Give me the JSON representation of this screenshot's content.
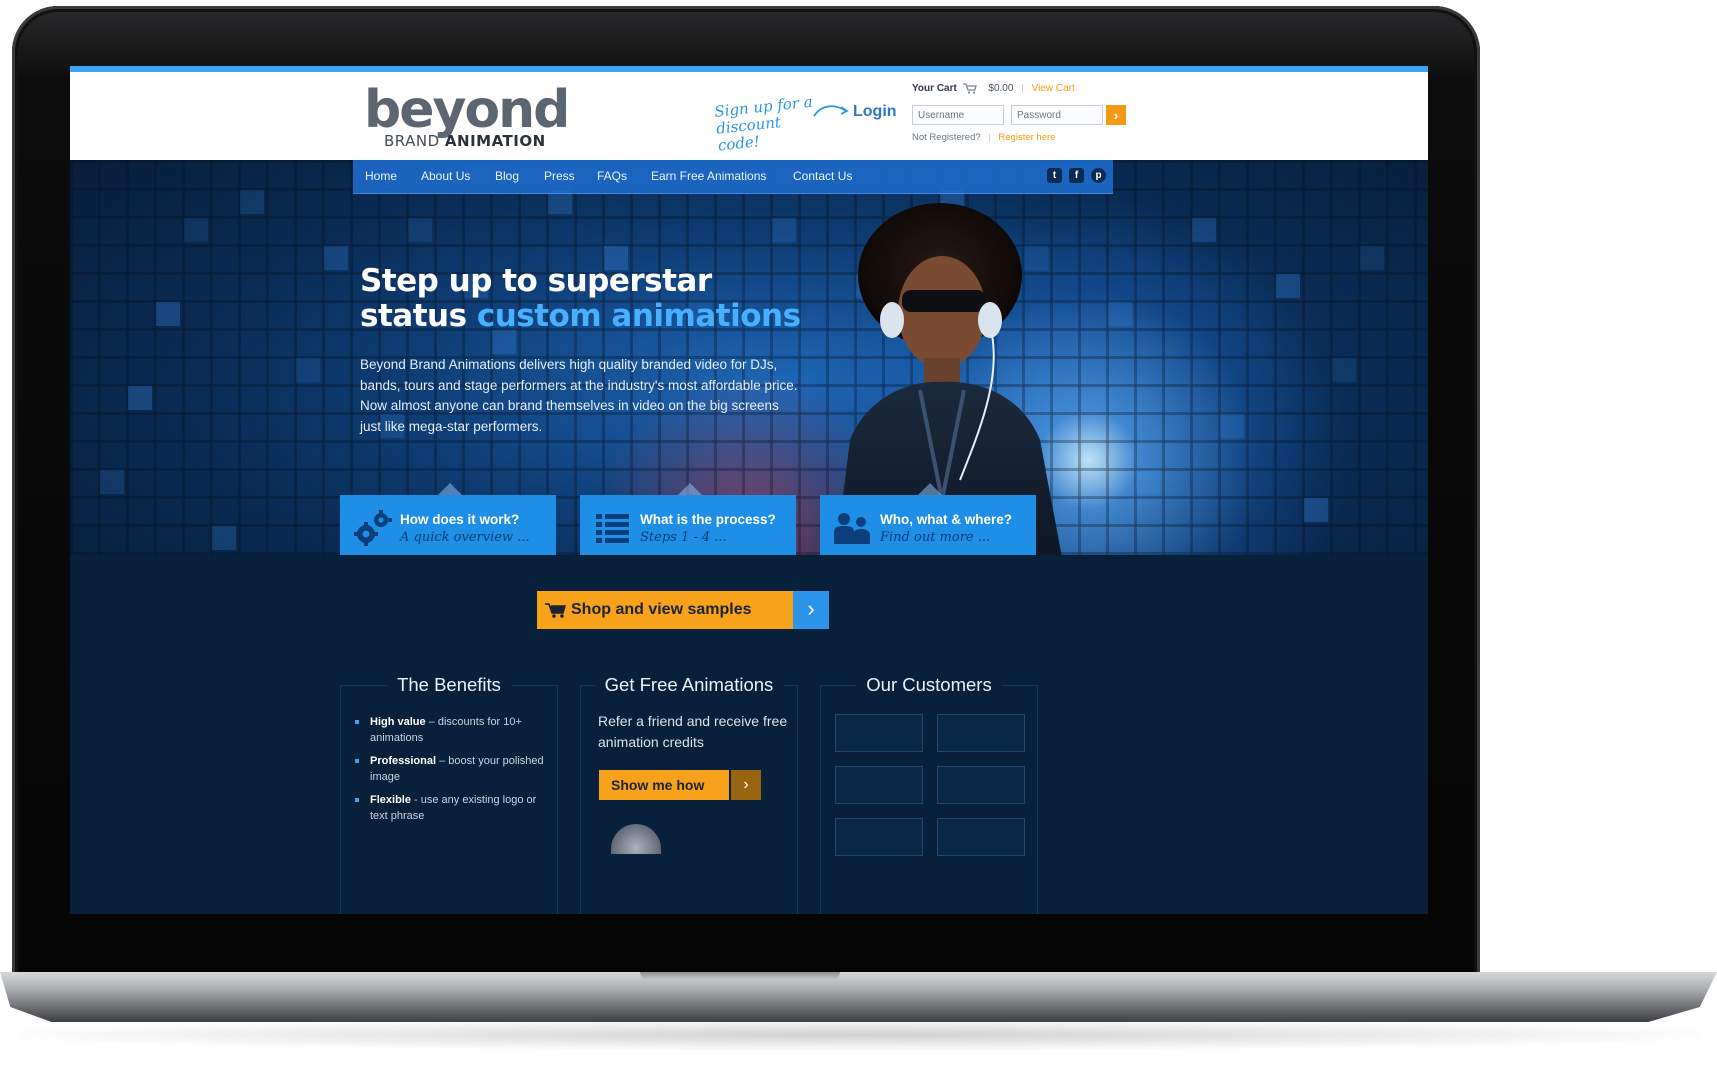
{
  "header": {
    "logo_main": "beyond",
    "logo_sub_left": "BRAND",
    "logo_sub_right": "ANIMATION",
    "signup_note": "Sign up for a discount code!",
    "login_label": "Login",
    "cart": {
      "label": "Your Cart",
      "amount": "$0.00",
      "view_link": "View Cart"
    },
    "username_placeholder": "Username",
    "password_placeholder": "Password",
    "go_label": "›",
    "not_registered": "Not Registered?",
    "register_link": "Register here"
  },
  "nav": {
    "items": [
      "Home",
      "About Us",
      "Blog",
      "Press",
      "FAQs",
      "Earn Free Animations",
      "Contact Us"
    ],
    "social": [
      "twitter-icon",
      "facebook-icon",
      "pinterest-icon"
    ]
  },
  "hero": {
    "headline_line1": "Step up to superstar",
    "headline_line2_plain": "status",
    "headline_line2_highlight": "custom animations",
    "paragraph": "Beyond Brand Animations delivers high quality branded video for DJs, bands, tours and stage performers at the industry's most affordable price. Now almost anyone can brand themselves in video on the big screens just like mega-star performers."
  },
  "features": [
    {
      "title": "How does it work?",
      "subtitle": "A quick overview ...",
      "icon": "gears-icon"
    },
    {
      "title": "What is the process?",
      "subtitle": "Steps 1 - 4 ...",
      "icon": "list-icon"
    },
    {
      "title": "Who, what & where?",
      "subtitle": "Find out more ...",
      "icon": "people-icon"
    }
  ],
  "cta": {
    "label": "Shop and view samples",
    "arrow": "›"
  },
  "columns": {
    "benefits": {
      "title": "The Benefits",
      "items": [
        {
          "bold": "High value",
          "text": " – discounts for 10+ animations"
        },
        {
          "bold": "Professional",
          "text": " – boost your polished image"
        },
        {
          "bold": "Flexible",
          "text": " - use any existing logo or text phrase"
        }
      ]
    },
    "free": {
      "title": "Get Free Animations",
      "text": "Refer a friend and receive free animation credits",
      "button": "Show me how",
      "arrow": "›"
    },
    "customers": {
      "title": "Our Customers"
    }
  },
  "colors": {
    "accent_blue": "#1e8ee6",
    "accent_orange": "#f7a21a",
    "dark_bg": "#082039"
  }
}
